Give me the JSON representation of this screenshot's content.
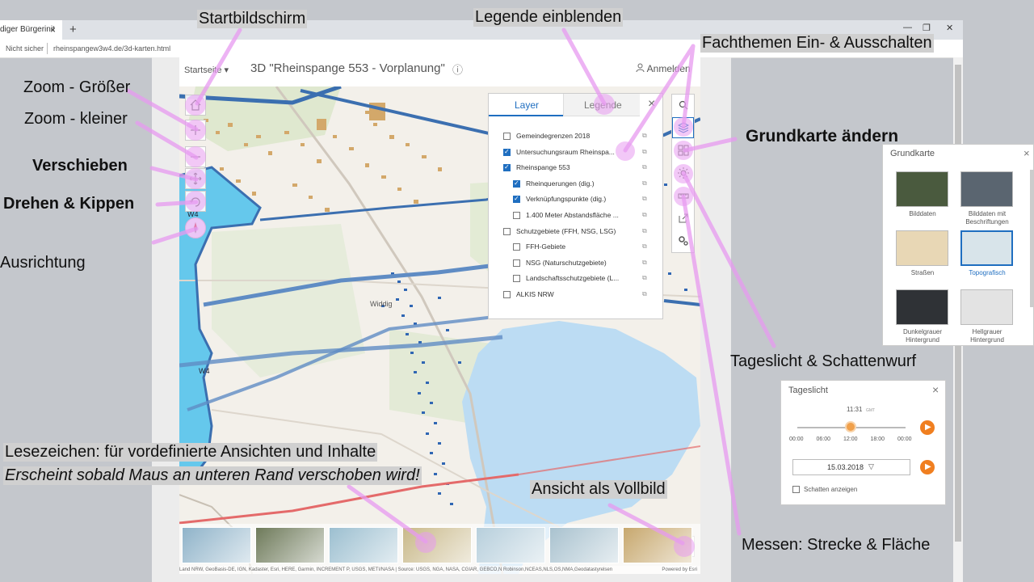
{
  "browser": {
    "tab_title": "diger Bürgerinit",
    "tab_close": "×",
    "new_tab": "+",
    "minimize": "—",
    "restore": "❐",
    "close": "✕",
    "security": "Nicht sicher",
    "url": "rheinspangew3w4.de/3d-karten.html"
  },
  "header": {
    "home_menu": "Startseite",
    "home_menu_arrow": "▾",
    "title": "3D \"Rheinspange 553 - Vorplanung\"",
    "info_icon": "ⓘ",
    "signin": "Anmelden"
  },
  "map": {
    "labels": [
      "W4",
      "W4",
      "Widdig"
    ],
    "attribution": "Land NRW, GeoBasis-DE, IGN, Kadaster, Esri, HERE, Garmin, INCREMENT P, USGS, METI/NASA | Source: USGS, NGA, NASA, CGIAR, GEBCO,N Robinson,NCEAS,NLS,OS,NMA,Geodatastyrelsen",
    "powered": "Powered by Esri"
  },
  "layer_panel": {
    "tab_layer": "Layer",
    "tab_legend": "Legende",
    "close": "×",
    "items": [
      {
        "label": "Gemeindegrenzen 2018",
        "checked": false,
        "indent": 0
      },
      {
        "label": "Untersuchungsraum Rheinspa...",
        "checked": true,
        "indent": 0
      },
      {
        "label": "Rheinspange 553",
        "checked": true,
        "indent": 0
      },
      {
        "label": "Rheinquerungen (dig.)",
        "checked": true,
        "indent": 1
      },
      {
        "label": "Verknüpfungspunkte (dig.)",
        "checked": true,
        "indent": 1
      },
      {
        "label": "1.400 Meter Abstandsfläche ...",
        "checked": false,
        "indent": 1
      },
      {
        "label": "Schutzgebiete (FFH, NSG, LSG)",
        "checked": false,
        "indent": 0
      },
      {
        "label": "FFH-Gebiete",
        "checked": false,
        "indent": 1
      },
      {
        "label": "NSG (Naturschutzgebiete)",
        "checked": false,
        "indent": 1
      },
      {
        "label": "Landschaftsschutzgebiete (L...",
        "checked": false,
        "indent": 1
      },
      {
        "label": "ALKIS NRW",
        "checked": false,
        "indent": 0
      }
    ]
  },
  "basemap": {
    "title": "Grundkarte",
    "close": "×",
    "options": [
      {
        "label": "Bilddaten",
        "selected": false,
        "color": "#4a5a3e"
      },
      {
        "label": "Bilddaten mit Beschriftungen",
        "selected": false,
        "color": "#5a6570"
      },
      {
        "label": "Straßen",
        "selected": false,
        "color": "#e8d7b5"
      },
      {
        "label": "Topografisch",
        "selected": true,
        "color": "#d8e4ea"
      },
      {
        "label": "Dunkelgrauer Hintergrund",
        "selected": false,
        "color": "#2f3236"
      },
      {
        "label": "Hellgrauer Hintergrund",
        "selected": false,
        "color": "#e3e3e3"
      }
    ]
  },
  "daylight": {
    "title": "Tageslicht",
    "close": "×",
    "time": "11:31",
    "tz": "GMT",
    "ticks": [
      "00:00",
      "06:00",
      "12:00",
      "18:00",
      "00:00"
    ],
    "slider_fraction": 0.49,
    "date": "15.03.2018",
    "date_arrow": "▽",
    "shadow_label": "Schatten anzeigen",
    "shadow_checked": false
  },
  "callouts": {
    "home": "Startbildschirm",
    "legend": "Legende einblenden",
    "layers": "Fachthemen Ein- & Ausschalten",
    "zoom_in": "Zoom - Größer",
    "zoom_out": "Zoom - kleiner",
    "pan": "Verschieben",
    "rotate": "Drehen & Kippen",
    "compass": "Ausrichtung",
    "basemap": "Grundkarte ändern",
    "daylight": "Tageslicht & Schattenwurf",
    "bookmarks_line1": "Lesezeichen: für vordefinierte Ansichten und Inhalte",
    "bookmarks_line2": "Erscheint sobald Maus an unteren Rand verschoben wird!",
    "fullscreen": "Ansicht als Vollbild",
    "measure": "Messen: Strecke & Fläche"
  },
  "bookmarks": [
    {
      "color": "#8fb3c9"
    },
    {
      "color": "#6e7a5a"
    },
    {
      "color": "#9cbfd0"
    },
    {
      "color": "#c9b98a"
    },
    {
      "color": "#b7cfdc"
    },
    {
      "color": "#a9c2cf"
    },
    {
      "color": "#c7a86e"
    }
  ],
  "colors": {
    "accent": "#1f6ec0",
    "highlight": "#e79af0",
    "boundary": "#3b6fb0",
    "water": "#b9dcf3",
    "buildings": "#d3a86a"
  }
}
